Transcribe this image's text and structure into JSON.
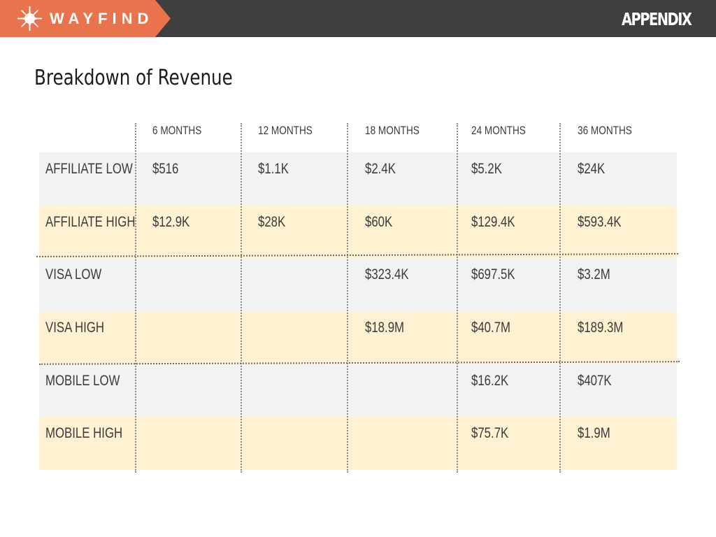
{
  "header": {
    "brand": "WAYFIND",
    "section": "APPENDIX",
    "colors": {
      "bar": "#3f3f3f",
      "brand_tab": "#e8734d"
    },
    "logo_icon": "compass-icon"
  },
  "page_title": "Breakdown of Revenue",
  "table": {
    "columns": [
      "6 MONTHS",
      "12 MONTHS",
      "18 MONTHS",
      "24 MONTHS",
      "36 MONTHS"
    ],
    "rows": [
      {
        "label": "AFFILIATE LOW",
        "values": [
          "$516",
          "$1.1K",
          "$2.4K",
          "$5.2K",
          "$24K"
        ]
      },
      {
        "label": "AFFILIATE HIGH",
        "values": [
          "$12.9K",
          "$28K",
          "$60K",
          "$129.4K",
          "$593.4K"
        ]
      },
      {
        "label": "VISA LOW",
        "values": [
          "",
          "",
          "$323.4K",
          "$697.5K",
          "$3.2M"
        ]
      },
      {
        "label": "VISA HIGH",
        "values": [
          "",
          "",
          "$18.9M",
          "$40.7M",
          "$189.3M"
        ]
      },
      {
        "label": "MOBILE LOW",
        "values": [
          "",
          "",
          "",
          "$16.2K",
          "$407K"
        ]
      },
      {
        "label": "MOBILE HIGH",
        "values": [
          "",
          "",
          "",
          "$75.7K",
          "$1.9M"
        ]
      }
    ],
    "row_colors": [
      "#f2f2f2",
      "#fef2d2"
    ]
  }
}
